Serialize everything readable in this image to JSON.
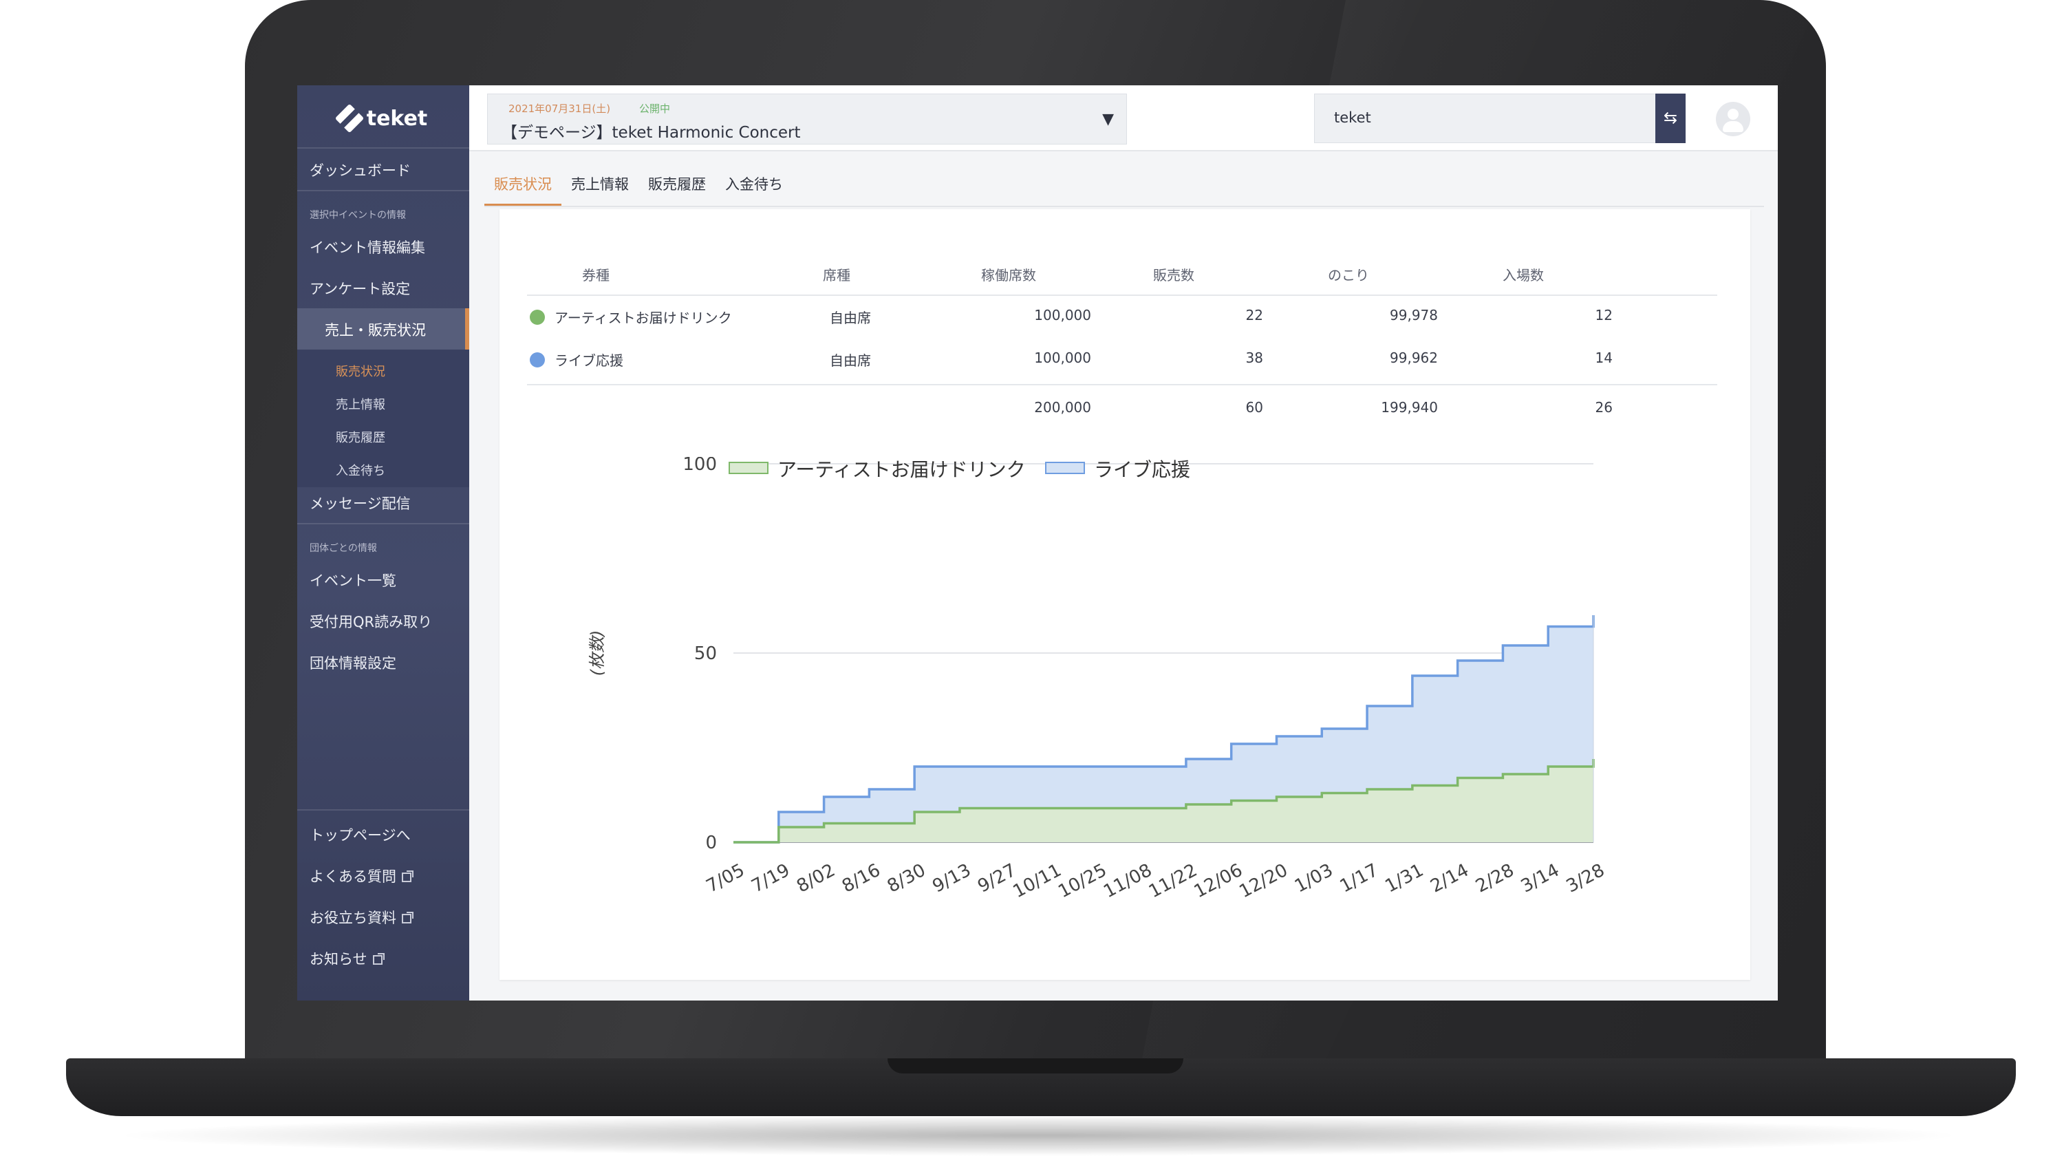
{
  "sidebar": {
    "logo": "teket",
    "dashboard": "ダッシュボード",
    "caption_event": "選択中イベントの情報",
    "event_edit": "イベント情報編集",
    "survey": "アンケート設定",
    "sales_status": "売上・販売状況",
    "sub_items": [
      "販売状況",
      "売上情報",
      "販売履歴",
      "入金待ち"
    ],
    "message": "メッセージ配信",
    "caption_org": "団体ごとの情報",
    "event_list": "イベント一覧",
    "qr": "受付用QR読み取り",
    "org_settings": "団体情報設定",
    "top_page": "トップページへ",
    "faq": "よくある質問",
    "resources": "お役立ち資料",
    "news": "お知らせ"
  },
  "header": {
    "event_date": "2021年07月31日(土)",
    "event_status": "公開中",
    "event_name": "【デモページ】teket Harmonic Concert",
    "organization": "teket",
    "swap_icon": "swap-arrows-icon",
    "avatar_icon": "user-avatar-icon"
  },
  "tabs": [
    "販売状況",
    "売上情報",
    "販売履歴",
    "入金待ち"
  ],
  "table": {
    "headers": [
      "券種",
      "席種",
      "稼働席数",
      "販売数",
      "のこり",
      "入場数"
    ],
    "rows": [
      {
        "name": "アーティストお届けドリンク",
        "seat": "自由席",
        "capacity": "100,000",
        "sold": "22",
        "remaining": "99,978",
        "entered": "12",
        "color": "#7fb86a"
      },
      {
        "name": "ライブ応援",
        "seat": "自由席",
        "capacity": "100,000",
        "sold": "38",
        "remaining": "99,962",
        "entered": "14",
        "color": "#6f9de0"
      }
    ],
    "totals": {
      "capacity": "200,000",
      "sold": "60",
      "remaining": "199,940",
      "entered": "26"
    }
  },
  "chart_data": {
    "type": "area",
    "stacked": true,
    "ylabel": "(枚数)",
    "ylim": [
      0,
      100
    ],
    "yticks": [
      0,
      50,
      100
    ],
    "categories": [
      "7/05",
      "7/19",
      "8/02",
      "8/16",
      "8/30",
      "9/13",
      "9/27",
      "10/11",
      "10/25",
      "11/08",
      "11/22",
      "12/06",
      "12/20",
      "1/03",
      "1/17",
      "1/31",
      "2/14",
      "2/28",
      "3/14",
      "3/28"
    ],
    "series": [
      {
        "name": "アーティストお届けドリンク",
        "color": "#7fb86a",
        "fill": "#dbead2",
        "values": [
          0,
          4,
          5,
          5,
          8,
          9,
          9,
          9,
          9,
          9,
          10,
          11,
          12,
          13,
          14,
          15,
          17,
          18,
          20,
          22
        ]
      },
      {
        "name": "ライブ応援",
        "color": "#6f9de0",
        "fill": "#d4e2f5",
        "values": [
          0,
          8,
          12,
          14,
          20,
          20,
          20,
          20,
          20,
          20,
          22,
          26,
          28,
          30,
          36,
          44,
          48,
          52,
          57,
          60
        ]
      }
    ],
    "legend": "top-left",
    "grid": true
  }
}
